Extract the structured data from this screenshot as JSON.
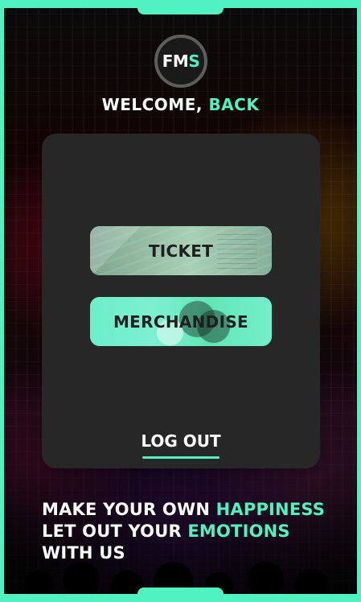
{
  "brand": {
    "logo_left": "FM",
    "logo_right": "S"
  },
  "header": {
    "welcome_prefix": "WELCOME, ",
    "welcome_accent": "BACK"
  },
  "menu": {
    "ticket_label": "TICKET",
    "merch_label": "MERCHANDISE",
    "logout_label": "LOG OUT"
  },
  "tagline": {
    "line1_prefix": "MAKE YOUR OWN ",
    "line1_accent": "HAPPINESS",
    "line2_prefix": "LET OUT YOUR ",
    "line2_accent": "EMOTIONS",
    "line3": "WITH US"
  },
  "colors": {
    "accent": "#4ff3c0",
    "panel": "#272727",
    "text": "#ffffff"
  }
}
